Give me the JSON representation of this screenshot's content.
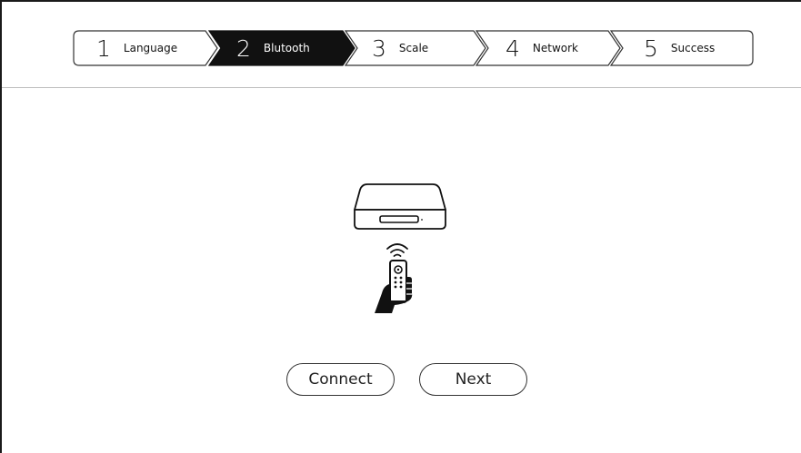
{
  "wizard": {
    "active_index": 1,
    "steps": [
      {
        "number": "1",
        "label": "Language"
      },
      {
        "number": "2",
        "label": "Blutooth"
      },
      {
        "number": "3",
        "label": "Scale"
      },
      {
        "number": "4",
        "label": "Network"
      },
      {
        "number": "5",
        "label": "Success"
      }
    ]
  },
  "illustration": {
    "device_icon": "tv-box-icon",
    "signal_icon": "wifi-signal-icon",
    "remote_icon": "hand-remote-icon"
  },
  "actions": {
    "connect_label": "Connect",
    "next_label": "Next"
  },
  "colors": {
    "active_step": "#111111",
    "border": "#333333",
    "divider": "#bdbdbd"
  }
}
